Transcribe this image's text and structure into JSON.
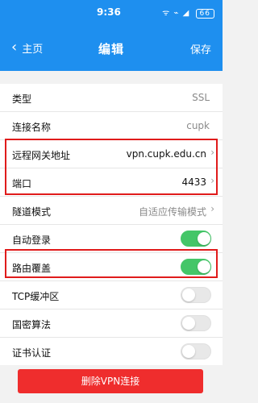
{
  "status_bar": {
    "time": "9:36",
    "icons": "ᯤ ⌁ ◢",
    "battery": "66"
  },
  "nav": {
    "back_label": "主页",
    "back_icon": "chevron-left-icon",
    "title": "编辑",
    "save_label": "保存"
  },
  "rows": [
    {
      "label": "类型",
      "value": "SSL"
    },
    {
      "label": "连接名称",
      "value": "cupk"
    },
    {
      "label": "远程网关地址",
      "value": "vpn.cupk.edu.cn"
    },
    {
      "label": "端口",
      "value": "4433"
    },
    {
      "label": "隧道模式",
      "value": "自适应传输模式"
    },
    {
      "label": "自动登录",
      "on": true
    },
    {
      "label": "路由覆盖",
      "on": true
    },
    {
      "label": "TCP缓冲区",
      "on": false
    },
    {
      "label": "国密算法",
      "on": false
    },
    {
      "label": "证书认证",
      "on": false
    }
  ],
  "delete_button": {
    "label": "删除VPN连接"
  },
  "colors": {
    "primary": "#1e8fef",
    "switch_on": "#44c668",
    "delete": "#ef2d2d",
    "highlight_box": "#e01b1b"
  }
}
